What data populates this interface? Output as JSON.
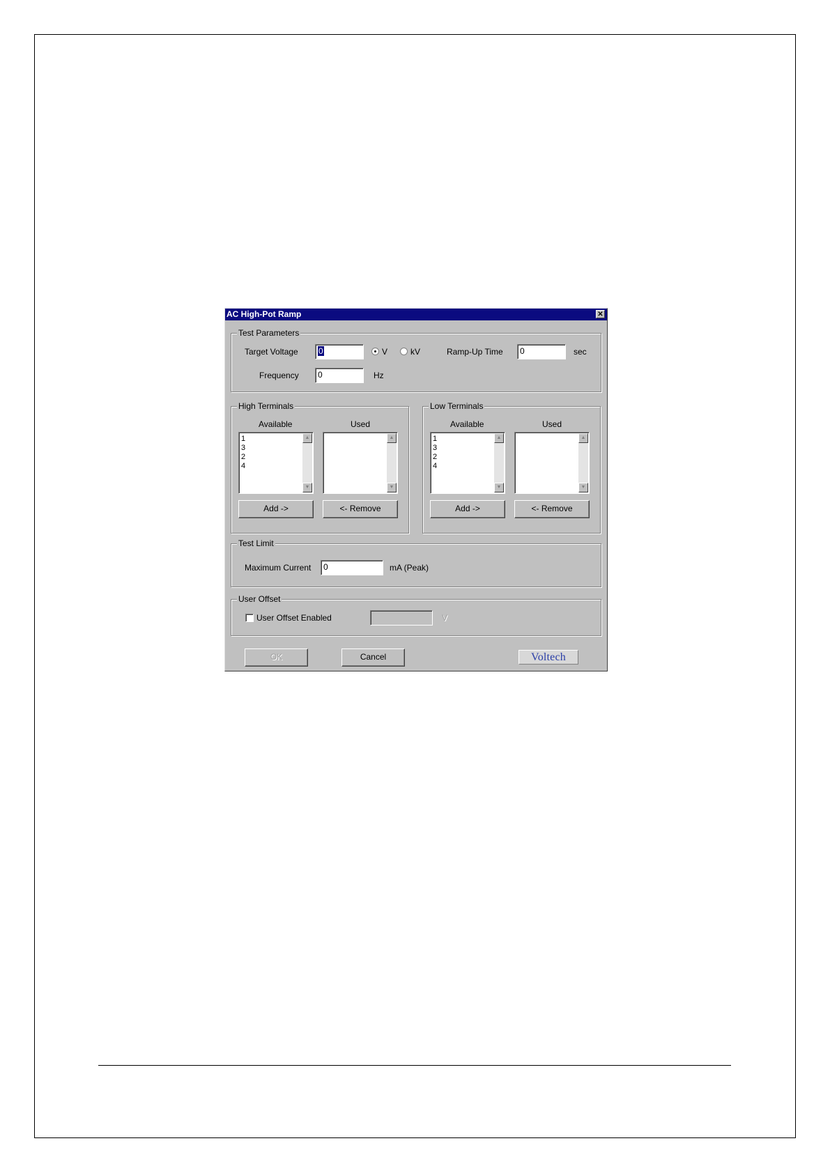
{
  "dialog": {
    "title": "AC High-Pot Ramp",
    "close_glyph": "✕"
  },
  "test_parameters": {
    "group_label": "Test Parameters",
    "target_voltage_label": "Target Voltage",
    "target_voltage_value": "0",
    "unit_v_label": "V",
    "unit_kv_label": "kV",
    "unit_selected": "V",
    "ramp_up_time_label": "Ramp-Up Time",
    "ramp_up_time_value": "0",
    "ramp_up_unit": "sec",
    "frequency_label": "Frequency",
    "frequency_value": "0",
    "frequency_unit": "Hz"
  },
  "high_terminals": {
    "group_label": "High Terminals",
    "available_label": "Available",
    "used_label": "Used",
    "available_items": [
      "1",
      "3",
      "2",
      "4"
    ],
    "used_items": [],
    "add_label": "Add ->",
    "remove_label": "<- Remove"
  },
  "low_terminals": {
    "group_label": "Low Terminals",
    "available_label": "Available",
    "used_label": "Used",
    "available_items": [
      "1",
      "3",
      "2",
      "4"
    ],
    "used_items": [],
    "add_label": "Add ->",
    "remove_label": "<- Remove"
  },
  "test_limit": {
    "group_label": "Test Limit",
    "max_current_label": "Maximum Current",
    "max_current_value": "0",
    "max_current_unit": "mA (Peak)"
  },
  "user_offset": {
    "group_label": "User Offset",
    "enabled_label": "User Offset Enabled",
    "enabled": false,
    "value": "",
    "unit": "V"
  },
  "footer": {
    "ok_label": "OK",
    "cancel_label": "Cancel",
    "logo_text": "Voltech"
  },
  "colors": {
    "titlebar": "#0b0b80",
    "dialog_face": "#c0c0c0",
    "logo_text": "#2b3fa8"
  }
}
